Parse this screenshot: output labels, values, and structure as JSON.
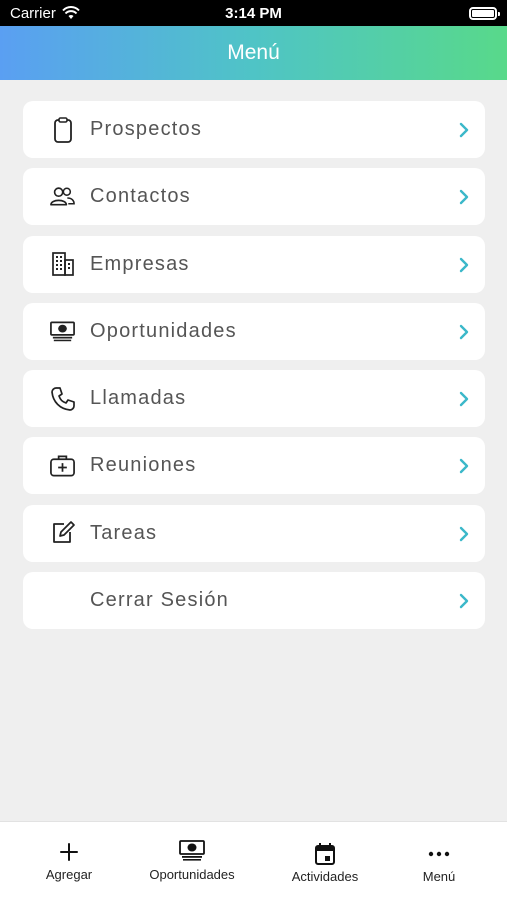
{
  "status_bar": {
    "carrier": "Carrier",
    "time": "3:14 PM"
  },
  "header": {
    "title": "Menú"
  },
  "menu": [
    {
      "label": "Prospectos",
      "icon": "clipboard-icon"
    },
    {
      "label": "Contactos",
      "icon": "people-icon"
    },
    {
      "label": "Empresas",
      "icon": "building-icon"
    },
    {
      "label": "Oportunidades",
      "icon": "money-icon"
    },
    {
      "label": "Llamadas",
      "icon": "phone-icon"
    },
    {
      "label": "Reuniones",
      "icon": "briefcase-plus-icon"
    },
    {
      "label": "Tareas",
      "icon": "edit-icon"
    },
    {
      "label": "Cerrar Sesión",
      "icon": ""
    }
  ],
  "tabs": [
    {
      "label": "Agregar",
      "icon": "plus-icon"
    },
    {
      "label": "Oportunidades",
      "icon": "money-icon"
    },
    {
      "label": "Actividades",
      "icon": "calendar-icon"
    },
    {
      "label": "Menú",
      "icon": "more-icon"
    }
  ],
  "colors": {
    "chevron": "#3bb8c9",
    "header_start": "#5a9ff2",
    "header_end": "#58d98a"
  }
}
